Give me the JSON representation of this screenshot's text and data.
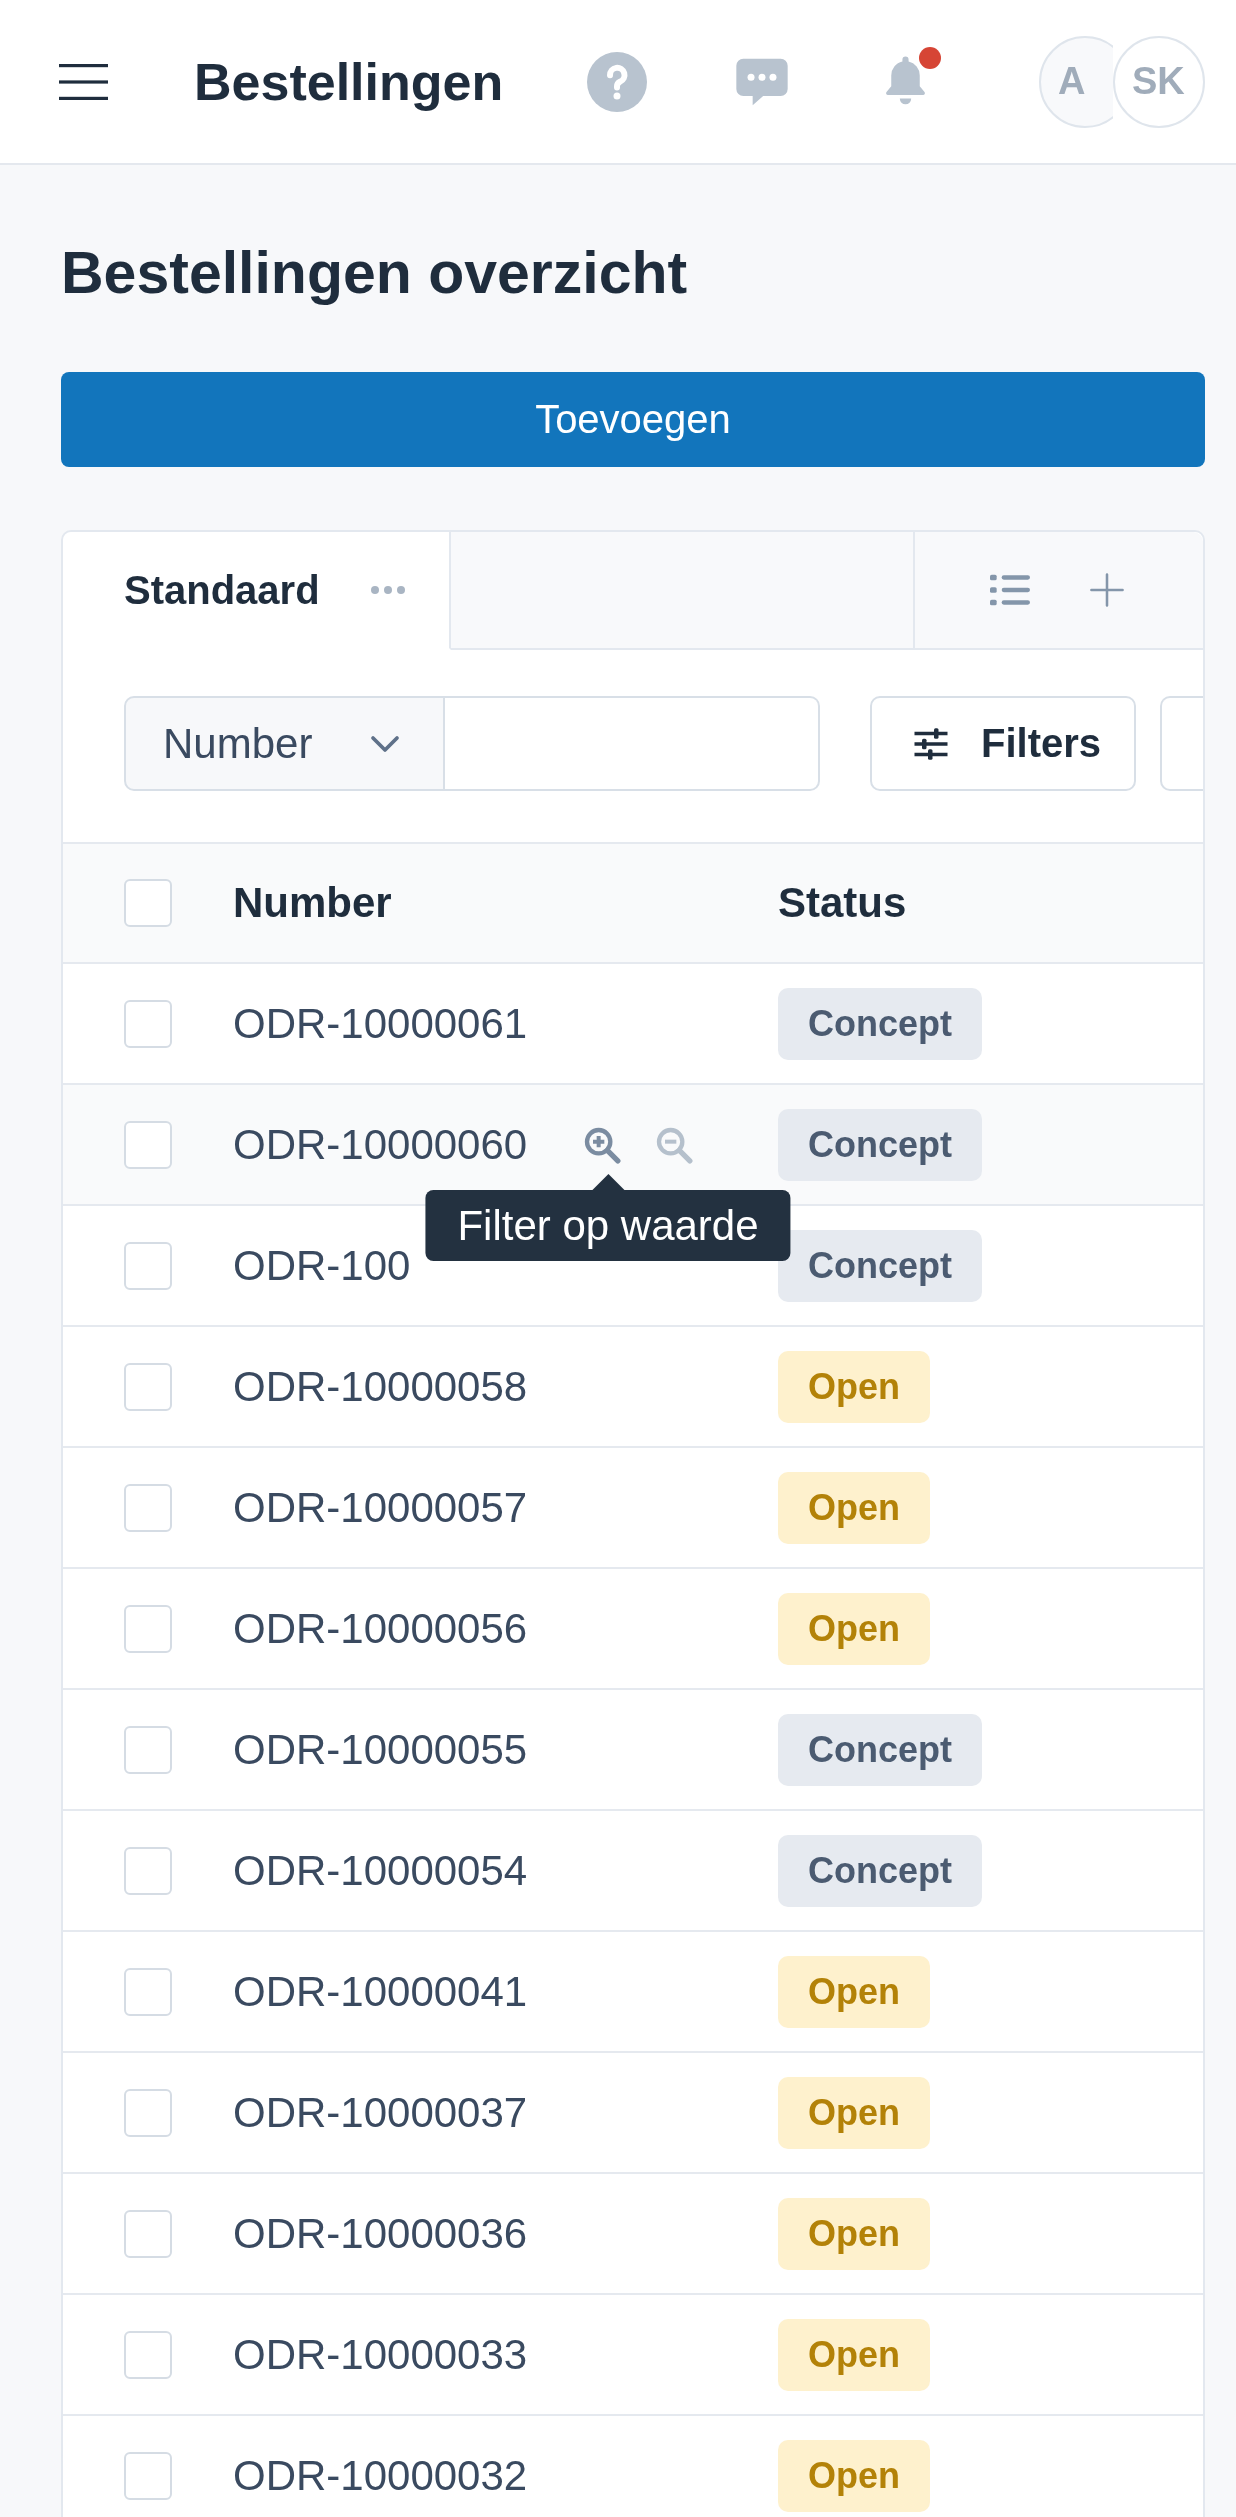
{
  "header": {
    "title": "Bestellingen",
    "notification_dot": true,
    "avatars": [
      {
        "initials": "A"
      },
      {
        "initials": "SK"
      }
    ]
  },
  "page": {
    "title": "Bestellingen overzicht",
    "add_button": "Toevoegen"
  },
  "tabs": [
    {
      "label": "Standaard",
      "selected": true
    }
  ],
  "filter_bar": {
    "field": "Number",
    "filters_button": "Filters"
  },
  "table": {
    "select_all_checked": false,
    "columns": [
      "Number",
      "Status"
    ],
    "rows": [
      {
        "number": "ODR-10000061",
        "status": {
          "label": "Concept",
          "kind": "neutral"
        },
        "checked": false,
        "hovered": false
      },
      {
        "number": "ODR-10000060",
        "status": {
          "label": "Concept",
          "kind": "neutral"
        },
        "checked": false,
        "hovered": true,
        "tooltip": "Filter op waarde"
      },
      {
        "number": "ODR-100",
        "status": {
          "label": "Concept",
          "kind": "neutral"
        },
        "checked": false,
        "hovered": false
      },
      {
        "number": "ODR-10000058",
        "status": {
          "label": "Open",
          "kind": "warning"
        },
        "checked": false,
        "hovered": false
      },
      {
        "number": "ODR-10000057",
        "status": {
          "label": "Open",
          "kind": "warning"
        },
        "checked": false,
        "hovered": false
      },
      {
        "number": "ODR-10000056",
        "status": {
          "label": "Open",
          "kind": "warning"
        },
        "checked": false,
        "hovered": false
      },
      {
        "number": "ODR-10000055",
        "status": {
          "label": "Concept",
          "kind": "neutral"
        },
        "checked": false,
        "hovered": false
      },
      {
        "number": "ODR-10000054",
        "status": {
          "label": "Concept",
          "kind": "neutral"
        },
        "checked": false,
        "hovered": false
      },
      {
        "number": "ODR-10000041",
        "status": {
          "label": "Open",
          "kind": "warning"
        },
        "checked": false,
        "hovered": false
      },
      {
        "number": "ODR-10000037",
        "status": {
          "label": "Open",
          "kind": "warning"
        },
        "checked": false,
        "hovered": false
      },
      {
        "number": "ODR-10000036",
        "status": {
          "label": "Open",
          "kind": "warning"
        },
        "checked": false,
        "hovered": false
      },
      {
        "number": "ODR-10000033",
        "status": {
          "label": "Open",
          "kind": "warning"
        },
        "checked": false,
        "hovered": false
      },
      {
        "number": "ODR-10000032",
        "status": {
          "label": "Open",
          "kind": "warning"
        },
        "checked": false,
        "hovered": false
      }
    ]
  }
}
